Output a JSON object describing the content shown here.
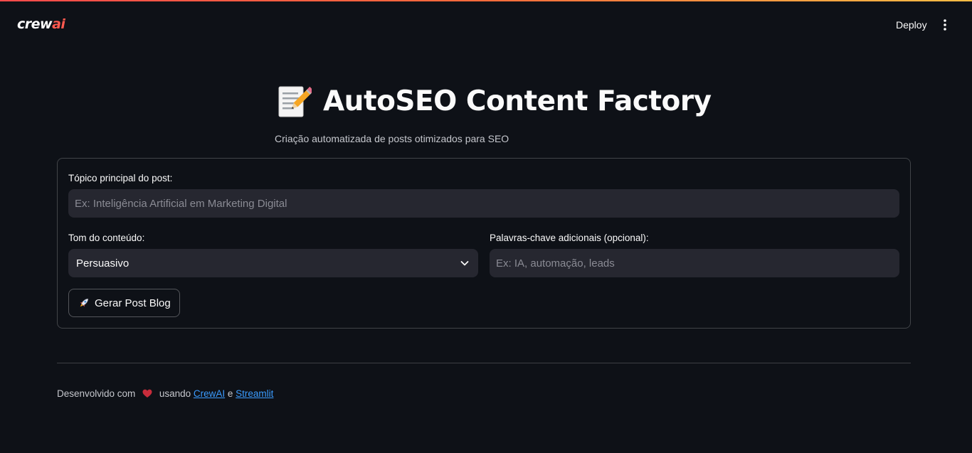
{
  "header": {
    "logo_main": "crew",
    "logo_ai": "ai",
    "deploy_label": "Deploy",
    "menu_icon": "vertical-dots-icon"
  },
  "main": {
    "title_icon": "memo-emoji",
    "title": "AutoSEO Content Factory",
    "subtitle": "Criação automatizada de posts otimizados para SEO"
  },
  "form": {
    "topic": {
      "label": "Tópico principal do post:",
      "value": "",
      "placeholder": "Ex: Inteligência Artificial em Marketing Digital"
    },
    "tone": {
      "label": "Tom do conteúdo:",
      "selected": "Persuasivo"
    },
    "keywords": {
      "label": "Palavras-chave adicionais (opcional):",
      "value": "",
      "placeholder": "Ex: IA, automação, leads"
    },
    "generate_button": {
      "icon": "rocket-emoji",
      "label": "Gerar Post Blog"
    }
  },
  "footer": {
    "prefix": "Desenvolvido com ",
    "heart_icon": "heart-icon",
    "middle": " usando ",
    "link1": "CrewAI",
    "conj": " e ",
    "link2": "Streamlit"
  },
  "colors": {
    "background": "#0e1117",
    "input_bg": "#262730",
    "link": "#3b9cff",
    "accent_red": "#ff4b4b",
    "heart": "#c72c3b"
  }
}
